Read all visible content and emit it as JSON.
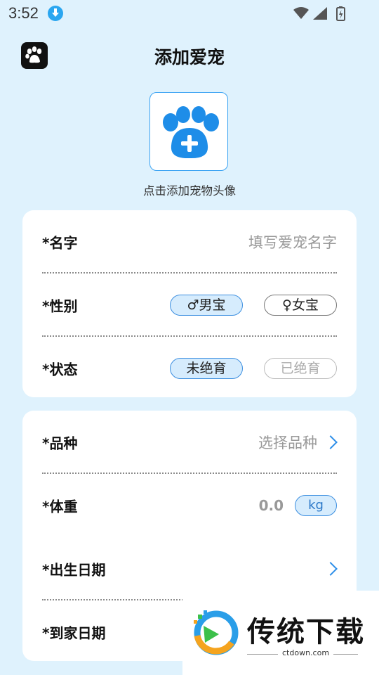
{
  "status_bar": {
    "time": "3:52",
    "icons": [
      "download-icon",
      "wifi-icon",
      "signal-icon",
      "battery-icon"
    ]
  },
  "header": {
    "title": "添加爱宠",
    "app_icon": "paw-icon"
  },
  "avatar": {
    "icon": "paw-plus-icon",
    "hint": "点击添加宠物头像"
  },
  "basic_info": {
    "name": {
      "label": "*名字",
      "placeholder": "填写爱宠名字"
    },
    "gender": {
      "label": "*性别",
      "options": [
        {
          "text": "♂男宝",
          "state": "selected"
        },
        {
          "text": "♀女宝",
          "state": "unselected"
        }
      ]
    },
    "status": {
      "label": "*状态",
      "options": [
        {
          "text": "未绝育",
          "state": "selected"
        },
        {
          "text": "已绝育",
          "state": "unselected"
        }
      ]
    }
  },
  "details": {
    "breed": {
      "label": "*品种",
      "placeholder": "选择品种"
    },
    "weight": {
      "label": "*体重",
      "value": "0.0",
      "unit": "kg"
    },
    "birth_date": {
      "label": "*出生日期"
    },
    "home_date": {
      "label": "*到家日期"
    }
  },
  "watermark": {
    "brand": "传统下载",
    "url": "ctdown.com"
  },
  "colors": {
    "background": "#dff2fd",
    "accent": "#3d8fe0",
    "accent_light": "#d6ecfd"
  }
}
